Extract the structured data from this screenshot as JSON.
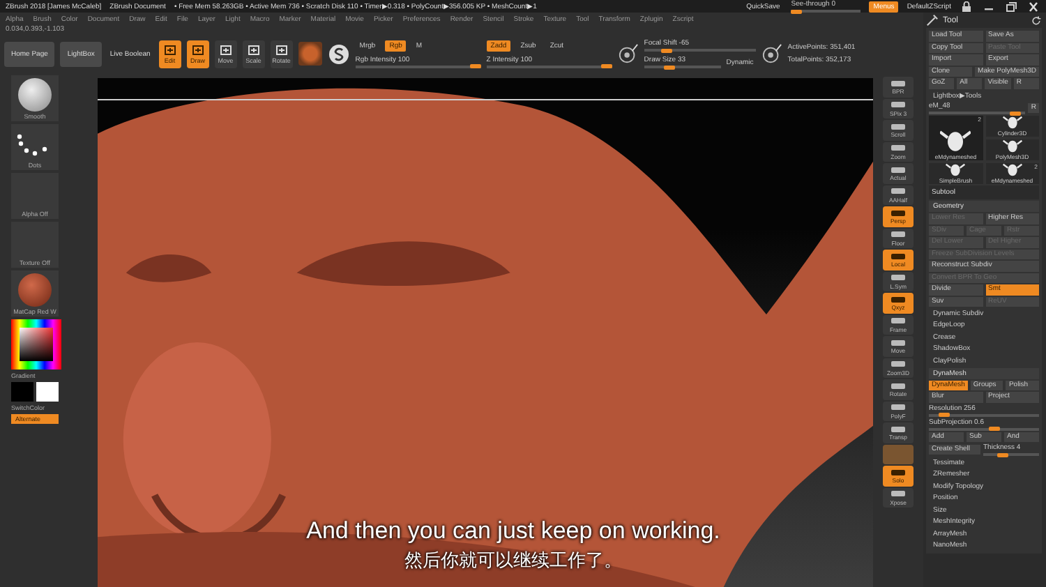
{
  "title_bar": {
    "app": "ZBrush 2018 [James McCaleb]",
    "document": "ZBrush Document",
    "stats": "• Free Mem 58.263GB • Active Mem 736 • Scratch Disk 110 • Timer▶0.318 • PolyCount▶356.005 KP • MeshCount▶1",
    "quicksave": "QuickSave",
    "see_through": {
      "label": "See-through  0",
      "level": 0
    },
    "menus": {
      "label": "Menus",
      "on": true
    },
    "script": "DefaultZScript"
  },
  "menu_bar": [
    "Alpha",
    "Brush",
    "Color",
    "Document",
    "Draw",
    "Edit",
    "File",
    "Layer",
    "Light",
    "Macro",
    "Marker",
    "Material",
    "Movie",
    "Picker",
    "Preferences",
    "Render",
    "Stencil",
    "Stroke",
    "Texture",
    "Tool",
    "Transform",
    "Zplugin",
    "Zscript"
  ],
  "coordinates": "0.034,0.393,-1.103",
  "toolbar": {
    "buttons": [
      "Home Page",
      "LightBox"
    ],
    "live_boolean": "Live Boolean",
    "modes": [
      {
        "label": "Edit",
        "selected": true
      },
      {
        "label": "Draw",
        "selected": true
      },
      {
        "label": "Move",
        "selected": false
      },
      {
        "label": "Scale",
        "selected": false
      },
      {
        "label": "Rotate",
        "selected": false
      }
    ],
    "color_modes": [
      {
        "label": "Mrgb",
        "on": false
      },
      {
        "label": "Rgb",
        "on": true
      },
      {
        "label": "M",
        "on": false
      }
    ],
    "rgb_intensity": {
      "label": "Rgb Intensity 100",
      "level": 1
    },
    "z_modes": [
      {
        "label": "Zadd",
        "on": true
      },
      {
        "label": "Zsub",
        "on": false
      },
      {
        "label": "Zcut",
        "on": false
      }
    ],
    "z_intensity": {
      "label": "Z Intensity 100",
      "level": 1
    },
    "focal_shift": {
      "label": "Focal Shift -65",
      "level": 0.17
    },
    "draw_size": {
      "label": "Draw Size 33",
      "level": 0.3
    },
    "dynamic": "Dynamic",
    "active_points": "ActivePoints: 351,401",
    "total_points": "TotalPoints: 352,173"
  },
  "left_panel": {
    "brush": "Smooth",
    "stroke": "Dots",
    "alpha": "Alpha Off",
    "texture": "Texture Off",
    "material": "MatCap Red W",
    "gradient": "Gradient",
    "switch_color": "SwitchColor",
    "alternate": "Alternate"
  },
  "subtitles": [
    "And then you can just keep on working.",
    "然后你就可以继续工作了。"
  ],
  "shelf": [
    {
      "kind": "button",
      "label": "BPR",
      "on": false
    },
    {
      "kind": "button",
      "label": "SPix 3",
      "on": false
    },
    {
      "kind": "button",
      "label": "Scroll",
      "on": false
    },
    {
      "kind": "button",
      "label": "Zoom",
      "on": false
    },
    {
      "kind": "button",
      "label": "Actual",
      "on": false
    },
    {
      "kind": "button",
      "label": "AAHalf",
      "on": false
    },
    {
      "kind": "button",
      "label": "Persp",
      "on": true
    },
    {
      "kind": "button",
      "label": "Floor",
      "on": false
    },
    {
      "kind": "button",
      "label": "Local",
      "on": true
    },
    {
      "kind": "button",
      "label": "L.Sym",
      "on": false
    },
    {
      "kind": "button",
      "label": "Qxyz",
      "on": true
    },
    {
      "kind": "button",
      "label": "Frame",
      "on": false
    },
    {
      "kind": "button",
      "label": "Move",
      "on": false
    },
    {
      "kind": "button",
      "label": "Zoom3D",
      "on": false
    },
    {
      "kind": "button",
      "label": "Rotate",
      "on": false
    },
    {
      "kind": "button",
      "label": "PolyF",
      "on": false
    },
    {
      "kind": "button",
      "label": "Transp",
      "on": false
    },
    {
      "kind": "swatch",
      "on": false
    },
    {
      "kind": "button",
      "label": "Solo",
      "on": true
    },
    {
      "kind": "button",
      "label": "Xpose",
      "on": false
    }
  ],
  "tool_panel": {
    "title": "Tool",
    "rows": [
      {
        "kind": "buttons",
        "items": [
          {
            "label": "Load Tool",
            "on": false,
            "disabled": false
          },
          {
            "label": "Save As",
            "on": false,
            "disabled": false
          }
        ]
      },
      {
        "kind": "buttons",
        "items": [
          {
            "label": "Copy Tool",
            "on": false,
            "disabled": false
          },
          {
            "label": "Paste Tool",
            "on": false,
            "disabled": true
          }
        ]
      },
      {
        "kind": "buttons",
        "items": [
          {
            "label": "Import",
            "on": false,
            "disabled": false
          },
          {
            "label": "Export",
            "on": false,
            "disabled": false
          }
        ]
      },
      {
        "kind": "buttons",
        "items": [
          {
            "label": "Clone",
            "on": false,
            "disabled": false
          },
          {
            "label": "Make PolyMesh3D",
            "on": false,
            "disabled": false
          }
        ]
      },
      {
        "kind": "buttons",
        "items": [
          {
            "label": "GoZ",
            "on": false,
            "disabled": false
          },
          {
            "label": "All",
            "on": false,
            "disabled": false
          },
          {
            "label": "Visible",
            "on": false,
            "disabled": false
          },
          {
            "label": "R",
            "on": false,
            "disabled": false
          }
        ]
      },
      {
        "kind": "item",
        "label": "Lightbox▶Tools"
      },
      {
        "kind": "slider",
        "label": "eM_48",
        "level": 0.95,
        "extra": "R"
      },
      {
        "kind": "thumbs",
        "items": [
          {
            "label": "eMdynameshed",
            "count": "2",
            "selected": true
          },
          {
            "label": "Cylinder3D",
            "selected": false
          },
          {
            "label": "PolyMesh3D",
            "selected": false
          },
          {
            "label": "SimpleBrush",
            "selected": false
          },
          {
            "label": "eMdynameshed",
            "count": "2",
            "selected": false
          }
        ]
      },
      {
        "kind": "header",
        "label": "Subtool"
      },
      {
        "kind": "section",
        "label": "Geometry"
      },
      {
        "kind": "buttons",
        "items": [
          {
            "label": "Lower Res",
            "on": false,
            "disabled": true
          },
          {
            "label": "Higher Res",
            "on": false,
            "disabled": false
          }
        ]
      },
      {
        "kind": "buttons",
        "items": [
          {
            "label": "SDiv",
            "on": false,
            "disabled": true
          },
          {
            "label": "Cage",
            "on": false,
            "disabled": true
          },
          {
            "label": "Rstr",
            "on": false,
            "disabled": true
          }
        ]
      },
      {
        "kind": "buttons",
        "items": [
          {
            "label": "Del Lower",
            "on": false,
            "disabled": true
          },
          {
            "label": "Del Higher",
            "on": false,
            "disabled": true
          }
        ]
      },
      {
        "kind": "buttons",
        "items": [
          {
            "label": "Freeze SubDivision Levels",
            "on": false,
            "disabled": true
          }
        ]
      },
      {
        "kind": "buttons",
        "items": [
          {
            "label": "Reconstruct Subdiv",
            "on": false,
            "disabled": false
          }
        ]
      },
      {
        "kind": "buttons",
        "items": [
          {
            "label": "Convert BPR To Geo",
            "on": false,
            "disabled": true
          }
        ]
      },
      {
        "kind": "buttons",
        "items": [
          {
            "label": "Divide",
            "on": false,
            "disabled": false
          },
          {
            "label": "Smt",
            "on": true,
            "disabled": false
          }
        ]
      },
      {
        "kind": "buttons",
        "items": [
          {
            "label": "Suv",
            "on": false,
            "disabled": false
          },
          {
            "label": "ReUV",
            "on": false,
            "disabled": true
          }
        ]
      },
      {
        "kind": "item",
        "label": "Dynamic Subdiv"
      },
      {
        "kind": "item",
        "label": "EdgeLoop"
      },
      {
        "kind": "item",
        "label": "Crease"
      },
      {
        "kind": "item",
        "label": "ShadowBox"
      },
      {
        "kind": "item",
        "label": "ClayPolish"
      },
      {
        "kind": "section",
        "label": "DynaMesh"
      },
      {
        "kind": "buttons",
        "items": [
          {
            "label": "DynaMesh",
            "on": true,
            "disabled": false
          },
          {
            "label": "Groups",
            "on": false,
            "disabled": false
          },
          {
            "label": "Polish",
            "on": false,
            "disabled": false
          }
        ]
      },
      {
        "kind": "buttons",
        "items": [
          {
            "label": "Blur",
            "on": false,
            "disabled": false
          },
          {
            "label": "Project",
            "on": false,
            "disabled": false
          }
        ]
      },
      {
        "kind": "slider",
        "label": "Resolution 256",
        "level": 0.1
      },
      {
        "kind": "slider",
        "label": "SubProjection 0.6",
        "level": 0.6
      },
      {
        "kind": "buttons",
        "items": [
          {
            "label": "Add",
            "on": false,
            "disabled": false
          },
          {
            "label": "Sub",
            "on": false,
            "disabled": false
          },
          {
            "label": "And",
            "on": false,
            "disabled": false
          }
        ]
      },
      {
        "kind": "button_slider",
        "button": "Create Shell",
        "slider": {
          "label": "Thickness 4",
          "level": 0.3
        }
      },
      {
        "kind": "item",
        "label": "Tessimate"
      },
      {
        "kind": "item",
        "label": "ZRemesher"
      },
      {
        "kind": "item",
        "label": "Modify Topology"
      },
      {
        "kind": "item",
        "label": "Position"
      },
      {
        "kind": "item",
        "label": "Size"
      },
      {
        "kind": "item",
        "label": "MeshIntegrity"
      },
      {
        "kind": "item",
        "label": "ArrayMesh"
      },
      {
        "kind": "item",
        "label": "NanoMesh"
      }
    ]
  }
}
